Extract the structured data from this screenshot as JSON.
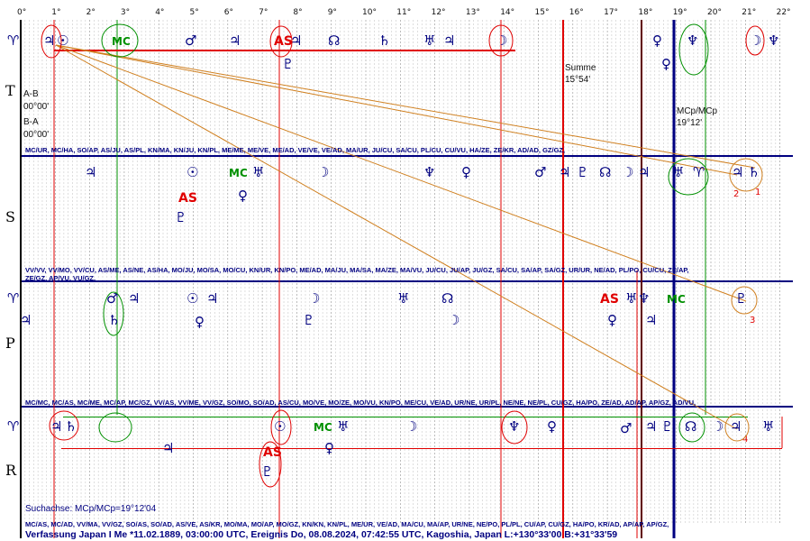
{
  "degrees": [
    "0°",
    "1°",
    "2°",
    "3°",
    "4°",
    "5°",
    "6°",
    "7°",
    "8°",
    "9°",
    "10°",
    "11°",
    "12°",
    "13°",
    "14°",
    "15°",
    "16°",
    "17°",
    "18°",
    "19°",
    "20°",
    "21°",
    "22°"
  ],
  "bands": [
    "T",
    "S",
    "P",
    "R"
  ],
  "notes": {
    "ab": "A-B",
    "ab_value": "00°00'",
    "ba": "B-A",
    "ba_value": "00°00'",
    "summe": "Summe",
    "summe_value": "15°54'",
    "mcp": "MCp/MCp",
    "mcp_value": "19°12'",
    "search_axis": "Suchachse: MCp/MCp=19°12'04"
  },
  "mid_rows": {
    "ts": "MC/UR, MC/HA, SO/AP, AS/JU, AS/PL, KN/MA, KN/JU, KN/PL, ME/ME, ME/VE, ME/AD, VE/VE, VE/AD, MA/UR, JU/CU, SA/CU, PL/CU, CU/VU, HA/ZE, ZE/KR, AD/AD, GZ/GZ,",
    "sp1": "VV/VV, VV/MO, VV/CU, AS/ME, AS/NE, AS/HA, MO/JU, MO/SA, MO/CU, KN/UR, KN/PO, ME/AD, MA/JU, MA/SA, MA/ZE, MA/VU, JU/CU, JU/AP, JU/GZ, SA/CU, SA/AP, SA/GZ, UR/UR, NE/AD, PL/PO, CU/CU, ZE/AP,",
    "sp2": "ZE/GZ, AP/VU, VU/GZ,",
    "pr": "MC/MC, MC/AS, MC/ME, MC/AP, MC/GZ, VV/AS, VV/ME, VV/GZ, SO/MO, SO/AD, AS/CU, MO/VE, MO/ZE, MO/VU, KN/PO, ME/CU, VE/AD, UR/NE, UR/PL, NE/NE, NE/PL, CU/GZ, HA/PO, ZE/AD, AD/AP, AP/GZ, AD/VU,",
    "bottom": "MC/AS, MC/AD, VV/MA, VV/GZ, SO/AS, SO/AD, AS/VE, AS/KR, MO/MA, MO/AP, MO/GZ, KN/KN, KN/PL, ME/UR, VE/AD, MA/CU, MA/AP, UR/NE, NE/PO, PL/PL, CU/AP, CU/GZ, HA/PO, KR/AD, AP/AP, AP/GZ,"
  },
  "labels": {
    "AS": "AS",
    "MC": "MC",
    "n1": "1",
    "n2": "2",
    "n3": "3",
    "n4": "4"
  },
  "footer": "Verfassung Japan I Me  *11.02.1889, 03:00:00 UTC, Ereignis Do, 08.08.2024, 07:42:55 UTC, Kagoshia, Japan L:+130°33'00 B:+31°33'59",
  "symbols": {
    "aries": "♈",
    "sun": "☉",
    "moon": "☽",
    "mercury": "☿",
    "venus": "♀",
    "mars": "♂",
    "jupiter": "♃",
    "saturn": "♄",
    "uranus": "♅",
    "neptune": "♆",
    "pluto": "♇",
    "node": "☊",
    "node_s": "☋"
  },
  "colors": {
    "navy": "#000080",
    "red": "#e00000",
    "green": "#009000",
    "orange": "#d08020",
    "grid": "#c0c0c0"
  }
}
